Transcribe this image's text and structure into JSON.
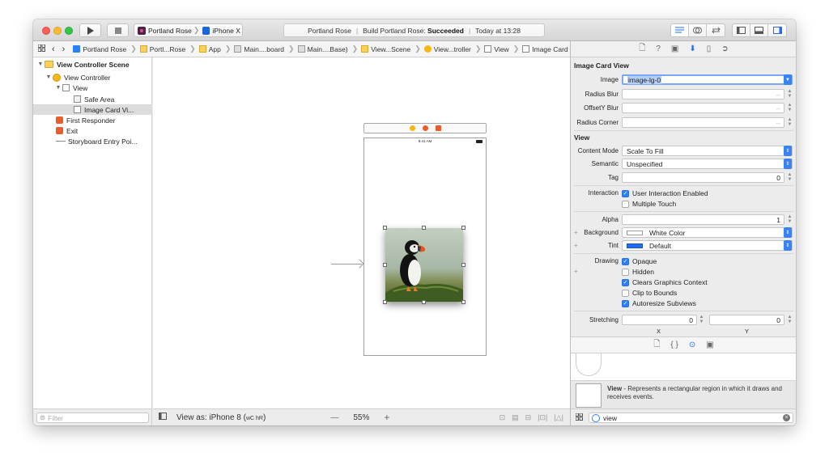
{
  "toolbar": {
    "scheme_app": "Portland Rose",
    "scheme_device": "iPhone X",
    "status_project": "Portland Rose",
    "status_build_prefix": "Build Portland Rose:",
    "status_build_result": "Succeeded",
    "status_time": "Today at 13:28"
  },
  "jumpbar": {
    "crumbs": [
      "Portland Rose",
      "Portl...Rose",
      "App",
      "Main....board",
      "Main....Base)",
      "View...Scene",
      "View...troller",
      "View",
      "Image Card View"
    ]
  },
  "outline": {
    "items": [
      {
        "label": "View Controller Scene"
      },
      {
        "label": "View Controller"
      },
      {
        "label": "View"
      },
      {
        "label": "Safe Area"
      },
      {
        "label": "Image Card Vi..."
      },
      {
        "label": "First Responder"
      },
      {
        "label": "Exit"
      },
      {
        "label": "Storyboard Entry Poi..."
      }
    ],
    "filter_placeholder": "Filter"
  },
  "canvas": {
    "status_time": "9:41 AM",
    "view_as": "View as: iPhone 8 (",
    "view_as_traits": "wC hR",
    "view_as_end": ")",
    "zoom_minus": "—",
    "zoom": "55%",
    "zoom_plus": "+"
  },
  "inspector": {
    "image_card": {
      "title": "Image Card View",
      "image_label": "Image",
      "image_value": "image-lg-0",
      "radius_blur_label": "Radius Blur",
      "offsety_blur_label": "OffsetY Blur",
      "radius_corner_label": "Radius Corner",
      "placeholder_dash": "--"
    },
    "view": {
      "title": "View",
      "content_mode_label": "Content Mode",
      "content_mode_value": "Scale To Fill",
      "semantic_label": "Semantic",
      "semantic_value": "Unspecified",
      "tag_label": "Tag",
      "tag_value": "0",
      "interaction_label": "Interaction",
      "user_interaction": "User Interaction Enabled",
      "multiple_touch": "Multiple Touch",
      "alpha_label": "Alpha",
      "alpha_value": "1",
      "background_label": "Background",
      "background_value": "White Color",
      "tint_label": "Tint",
      "tint_value": "Default",
      "drawing_label": "Drawing",
      "opaque": "Opaque",
      "hidden": "Hidden",
      "clears_graphics": "Clears Graphics Context",
      "clip_to_bounds": "Clip to Bounds",
      "autoresize": "Autoresize Subviews",
      "stretching_label": "Stretching",
      "stretch_x_value": "0",
      "stretch_y_value": "0",
      "x_label": "X",
      "y_label": "Y"
    },
    "library": {
      "item_name": "View",
      "item_desc": " - Represents a rectangular region in which it draws and receives events.",
      "search_value": "view"
    },
    "colors": {
      "accent": "#2d7ff9",
      "tint": "#1e6ef5",
      "background_swatch": "#ffffff"
    }
  }
}
